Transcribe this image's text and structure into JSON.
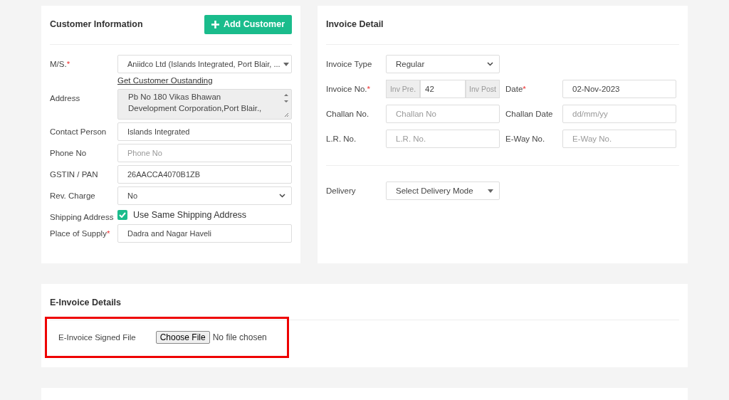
{
  "customer": {
    "title": "Customer Information",
    "add_button": "Add Customer",
    "fields": [
      {
        "kind": "dropdown",
        "label": "M/S.",
        "required_mark": "*",
        "value": "Aniidco Ltd (Islands Integrated, Port Blair, ...",
        "link": "Get Customer Oustanding"
      },
      {
        "kind": "textarea",
        "label": "Address",
        "lines": [
          "Pb No 180 Vikas Bhawan",
          "Development Corporation,Port Blair.,"
        ]
      },
      {
        "kind": "input",
        "label": "Contact Person",
        "value": "Islands Integrated"
      },
      {
        "kind": "input",
        "label": "Phone No",
        "placeholder": "Phone No"
      },
      {
        "kind": "input",
        "label": "GSTIN / PAN",
        "value": "26AACCA4070B1ZB"
      },
      {
        "kind": "select",
        "label": "Rev. Charge",
        "value": "No"
      },
      {
        "kind": "checkbox",
        "label": "Shipping Address",
        "checked": true,
        "text": "Use Same Shipping Address"
      },
      {
        "kind": "input",
        "label": "Place of Supply",
        "required_mark": "*",
        "value": "Dadra and Nagar Haveli"
      }
    ]
  },
  "invoice": {
    "title": "Invoice Detail",
    "type": {
      "label": "Invoice Type",
      "value": "Regular"
    },
    "number": {
      "label": "Invoice No.",
      "required_mark": "*",
      "prefix_placeholder": "Inv Pre.",
      "value": "42",
      "postfix_placeholder": "Inv Post"
    },
    "date": {
      "label": "Date",
      "required_mark": "*",
      "value": "02-Nov-2023"
    },
    "pairs": [
      {
        "label": "Challan No.",
        "placeholder": "Challan No",
        "label2": "Challan Date",
        "placeholder2": "dd/mm/yy"
      },
      {
        "label": "L.R. No.",
        "placeholder": "L.R. No.",
        "label2": "E-Way No.",
        "placeholder2": "E-Way No."
      }
    ],
    "delivery": {
      "label": "Delivery",
      "value": "Select Delivery Mode"
    }
  },
  "einvoice": {
    "title": "E-Invoice Details",
    "label": "E-Invoice Signed File",
    "button": "Choose File",
    "status": "No file chosen",
    "highlighted": true
  }
}
